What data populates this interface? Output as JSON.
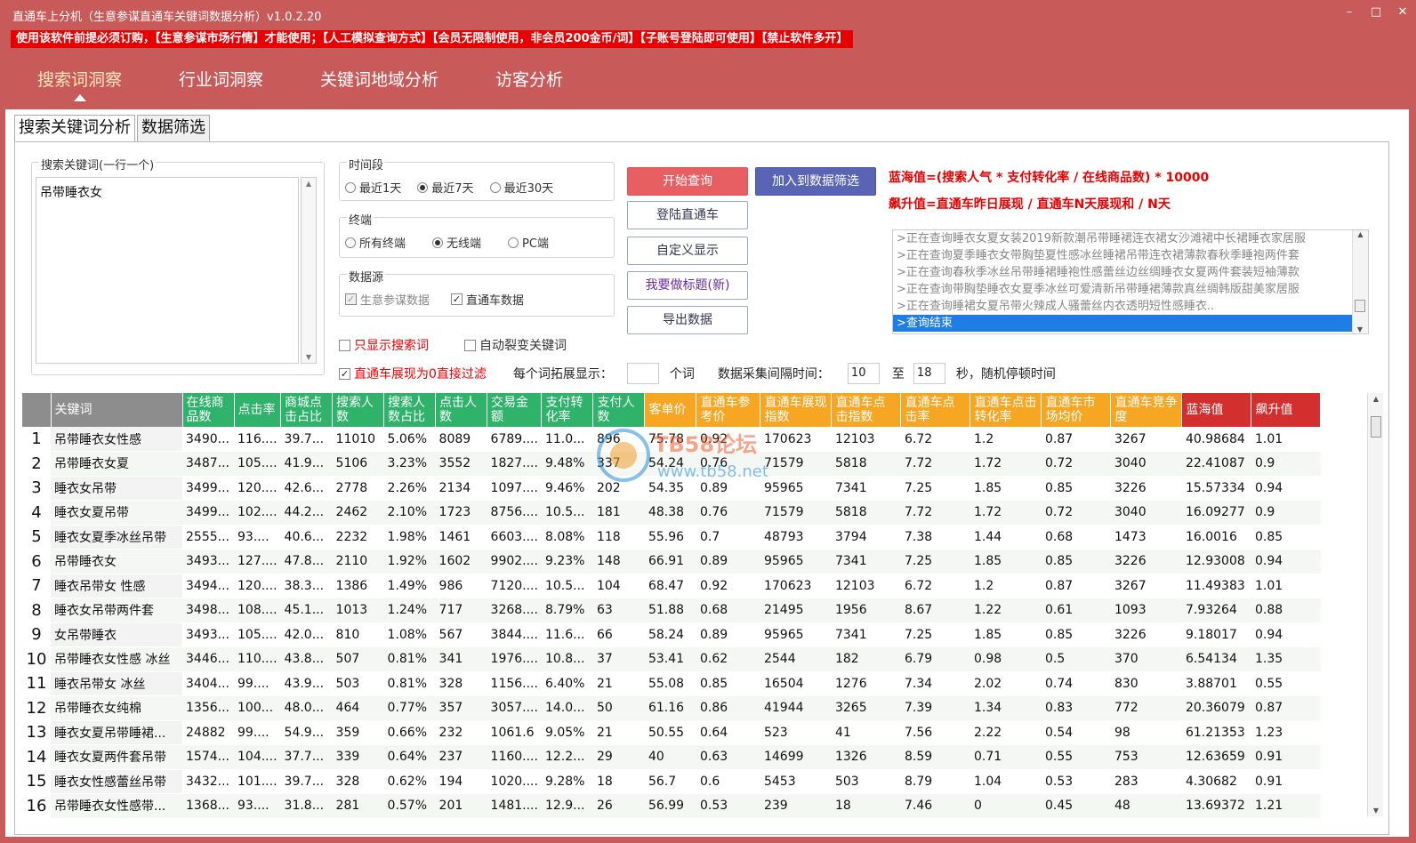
{
  "window": {
    "title": "直通车上分机（生意参谋直通车关键词数据分析）v1.0.2.20",
    "minimize": "–",
    "maximize": "□",
    "close": "✕"
  },
  "notice": "使用该软件前提必须订购，【生意参谋市场行情】才能使用；【人工模拟查询方式】【会员无限制使用，非会员200金币/词】【子账号登陆即可使用】【禁止软件多开】",
  "main_tabs": [
    "搜索词洞察",
    "行业词洞察",
    "关键词地域分析",
    "访客分析"
  ],
  "sub_tabs": [
    "搜索关键词分析",
    "数据筛选"
  ],
  "keywords": {
    "label": "搜索关键词(一行一个)",
    "value": "吊带睡衣女"
  },
  "period": {
    "label": "时间段",
    "options": [
      "最近1天",
      "最近7天",
      "最近30天"
    ],
    "selected": "最近7天"
  },
  "terminal": {
    "label": "终端",
    "options": [
      "所有终端",
      "无线端",
      "PC端"
    ],
    "selected": "无线端"
  },
  "datasource": {
    "label": "数据源",
    "options": [
      "生意参谋数据",
      "直通车数据"
    ]
  },
  "checkboxes": {
    "only_search": "只显示搜索词",
    "auto_split": "自动裂变关键词",
    "filter_zero": "直通车展现为0直接过滤"
  },
  "buttons": {
    "start": "开始查询",
    "add_filter": "加入到数据筛选",
    "login": "登陆直通车",
    "custom_display": "自定义显示",
    "make_title": "我要做标题(新)",
    "export": "导出数据"
  },
  "formulas": {
    "blue_ocean": "蓝海值=(搜索人气 * 支付转化率 / 在线商品数) * 10000",
    "surge": "飙升值=直通车昨日展现 / 直通车N天展现和 / N天"
  },
  "log_lines": [
    ">正在查询睡衣女夏女装2019新款潮吊带睡裙连衣裙女沙滩裙中长裙睡衣家居服",
    ">正在查询夏季睡衣女带胸垫夏性感冰丝睡裙吊带连衣裙薄款春秋季睡袍两件套",
    ">正在查询春秋季冰丝吊带睡裙睡袍性感蕾丝边丝绸睡衣女夏两件套装短袖薄款",
    ">正在查询带胸垫睡衣女夏季冰丝可爱清新吊带睡裙薄款真丝绸韩版甜美家居服",
    ">正在查询睡裙女夏吊带火辣成人骚蕾丝内衣透明短性感睡衣..",
    ">查询结束"
  ],
  "expand": {
    "label": "每个词拓展显示：",
    "value": "",
    "unit": "个词"
  },
  "interval": {
    "label": "数据采集间隔时间：",
    "from": "10",
    "to_label": "至",
    "to": "18",
    "suffix": "秒，随机停顿时间"
  },
  "watermark": {
    "brand": "TB58论坛",
    "url": "www.tb58.net"
  },
  "colors": {
    "green_header": "#2fb36b",
    "orange_header": "#f6a623",
    "red_header": "#d42f2f",
    "gray_header": "#8d8d8d",
    "window": "#c95a5a",
    "notice": "#e80000"
  },
  "table": {
    "headers": [
      "关键词",
      "在线商品数",
      "点击率",
      "商城点击占比",
      "搜索人数",
      "搜索人数占比",
      "点击人数",
      "交易金额",
      "支付转化率",
      "支付人数",
      "客单价",
      "直通车参考价",
      "直通车展现指数",
      "直通车点击指数",
      "直通车点击率",
      "直通车点击转化率",
      "直通车市场均价",
      "直通车竞争度",
      "蓝海值",
      "飙升值"
    ],
    "rows": [
      [
        "吊带睡衣女性感",
        "3490...",
        "116....",
        "39.7...",
        "11010",
        "5.06%",
        "8089",
        "6789....",
        "11.0...",
        "896",
        "75.78",
        "0.92",
        "170623",
        "12103",
        "6.72",
        "1.2",
        "0.87",
        "3267",
        "40.98684",
        "1.01"
      ],
      [
        "吊带睡衣女夏",
        "3487...",
        "105....",
        "41.9...",
        "5106",
        "3.23%",
        "3552",
        "1827....",
        "9.48%",
        "337",
        "54.24",
        "0.76",
        "71579",
        "5818",
        "7.72",
        "1.72",
        "0.72",
        "3040",
        "22.41087",
        "0.9"
      ],
      [
        "睡衣女吊带",
        "3499...",
        "120....",
        "42.6...",
        "2778",
        "2.26%",
        "2134",
        "1097....",
        "9.46%",
        "202",
        "54.35",
        "0.89",
        "95965",
        "7341",
        "7.25",
        "1.85",
        "0.85",
        "3226",
        "15.57334",
        "0.94"
      ],
      [
        "睡衣女夏吊带",
        "3499...",
        "102....",
        "44.2...",
        "2462",
        "2.10%",
        "1723",
        "8756....",
        "10.5...",
        "181",
        "48.38",
        "0.76",
        "71579",
        "5818",
        "7.72",
        "1.72",
        "0.72",
        "3040",
        "16.09277",
        "0.9"
      ],
      [
        "睡衣女夏季冰丝吊带",
        "2555...",
        "93....",
        "40.6...",
        "2232",
        "1.98%",
        "1461",
        "6603....",
        "8.08%",
        "118",
        "55.96",
        "0.7",
        "48793",
        "3794",
        "7.38",
        "1.44",
        "0.68",
        "1473",
        "16.0016",
        "0.85"
      ],
      [
        "吊带睡衣女",
        "3493...",
        "127....",
        "47.8...",
        "2110",
        "1.92%",
        "1602",
        "9902....",
        "9.23%",
        "148",
        "66.91",
        "0.89",
        "95965",
        "7341",
        "7.25",
        "1.85",
        "0.85",
        "3226",
        "12.93008",
        "0.94"
      ],
      [
        "睡衣吊带女 性感",
        "3494...",
        "120....",
        "38.3...",
        "1386",
        "1.49%",
        "986",
        "7120....",
        "10.5...",
        "104",
        "68.47",
        "0.92",
        "170623",
        "12103",
        "6.72",
        "1.2",
        "0.87",
        "3267",
        "11.49383",
        "1.01"
      ],
      [
        "睡衣女吊带两件套",
        "3498...",
        "108....",
        "45.1...",
        "1013",
        "1.24%",
        "717",
        "3268....",
        "8.79%",
        "63",
        "51.88",
        "0.68",
        "21495",
        "1956",
        "8.67",
        "1.22",
        "0.61",
        "1093",
        "7.93264",
        "0.88"
      ],
      [
        "女吊带睡衣",
        "3493...",
        "105....",
        "42.0...",
        "810",
        "1.08%",
        "567",
        "3844....",
        "11.6...",
        "66",
        "58.24",
        "0.89",
        "95965",
        "7341",
        "7.25",
        "1.85",
        "0.85",
        "3226",
        "9.18017",
        "0.94"
      ],
      [
        "吊带睡衣女性感 冰丝",
        "3446...",
        "110....",
        "43.8...",
        "507",
        "0.81%",
        "341",
        "1976....",
        "10.8...",
        "37",
        "53.41",
        "0.62",
        "2544",
        "182",
        "6.79",
        "0.98",
        "0.5",
        "370",
        "6.54134",
        "1.35"
      ],
      [
        "睡衣吊带女 冰丝",
        "3404...",
        "99....",
        "43.9...",
        "503",
        "0.81%",
        "328",
        "1156....",
        "6.40%",
        "21",
        "55.08",
        "0.85",
        "16504",
        "1276",
        "7.34",
        "2.02",
        "0.74",
        "830",
        "3.88701",
        "0.55"
      ],
      [
        "吊带睡衣女纯棉",
        "1356...",
        "100...",
        "48.0...",
        "464",
        "0.77%",
        "357",
        "3057....",
        "14.0...",
        "50",
        "61.16",
        "0.86",
        "41944",
        "3265",
        "7.39",
        "1.34",
        "0.83",
        "772",
        "20.36079",
        "0.87"
      ],
      [
        "睡衣女夏吊带睡裙...",
        "24882",
        "99....",
        "54.9...",
        "359",
        "0.66%",
        "232",
        "1061.6",
        "9.05%",
        "21",
        "50.55",
        "0.64",
        "523",
        "41",
        "7.56",
        "2.22",
        "0.54",
        "98",
        "61.21353",
        "1.23"
      ],
      [
        "睡衣女夏两件套吊带",
        "1574...",
        "104....",
        "37.7...",
        "339",
        "0.64%",
        "237",
        "1160....",
        "12.2...",
        "29",
        "40",
        "0.63",
        "14699",
        "1326",
        "8.59",
        "0.71",
        "0.55",
        "753",
        "12.63659",
        "0.91"
      ],
      [
        "睡衣女性感蕾丝吊带",
        "3432...",
        "101....",
        "39.7...",
        "328",
        "0.62%",
        "194",
        "1020....",
        "9.28%",
        "18",
        "56.7",
        "0.6",
        "5453",
        "503",
        "8.79",
        "1.04",
        "0.53",
        "283",
        "4.30682",
        "0.91"
      ],
      [
        "吊带睡衣女性感带...",
        "1368...",
        "93....",
        "31.8...",
        "281",
        "0.57%",
        "201",
        "1481....",
        "12.9...",
        "26",
        "56.99",
        "0.53",
        "239",
        "18",
        "7.46",
        "0",
        "0.45",
        "48",
        "13.69372",
        "1.21"
      ]
    ]
  }
}
